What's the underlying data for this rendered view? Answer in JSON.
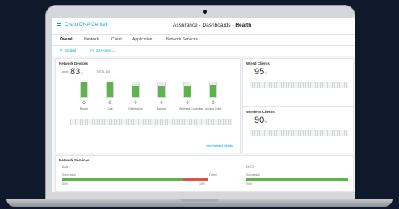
{
  "app": {
    "name": "Cisco DNA Center"
  },
  "page": {
    "title_prefix": "Assurance - Dashboards - ",
    "title_strong": "Health"
  },
  "tabs": [
    "Overall",
    "Network",
    "Client",
    "Application",
    "Network Services ⌄"
  ],
  "filters": {
    "location": "Global",
    "time": "24 Hours ⌄"
  },
  "network_devices": {
    "title": "Network Devices",
    "health_label": "Latest",
    "health_value": "83",
    "health_unit": "%",
    "total_label": "TOTAL 116",
    "devices": [
      {
        "label": "Router",
        "percent": 100,
        "icon": "router-icon"
      },
      {
        "label": "Core",
        "percent": 100,
        "icon": "core-switch-icon"
      },
      {
        "label": "Distribution",
        "percent": 75,
        "icon": "distribution-switch-icon"
      },
      {
        "label": "Access",
        "percent": 75,
        "icon": "access-switch-icon"
      },
      {
        "label": "Wireless Controller",
        "percent": 75,
        "icon": "wireless-controller-icon"
      },
      {
        "label": "Access Point",
        "percent": 85,
        "icon": "access-point-icon"
      }
    ],
    "link": "View Network Details"
  },
  "wired_clients": {
    "title": "Wired Clients",
    "health_value": "95",
    "health_unit": "%"
  },
  "wireless_clients": {
    "title": "Wireless Clients",
    "health_value": "90",
    "health_unit": "%"
  },
  "network_services": {
    "title": "Network Services",
    "left": {
      "name": "AAA",
      "row_label": "Successful",
      "percent_label": "80%",
      "fail_label": "Failed",
      "fail_percent": "15%",
      "success": 80,
      "fail": 15
    },
    "right": {
      "name": "DHCP",
      "row_label": "Successful",
      "percent_label": "95%",
      "success": 100
    }
  },
  "colors": {
    "accent": "#049fd9",
    "good": "#5eb44b",
    "bad": "#d9534f"
  }
}
